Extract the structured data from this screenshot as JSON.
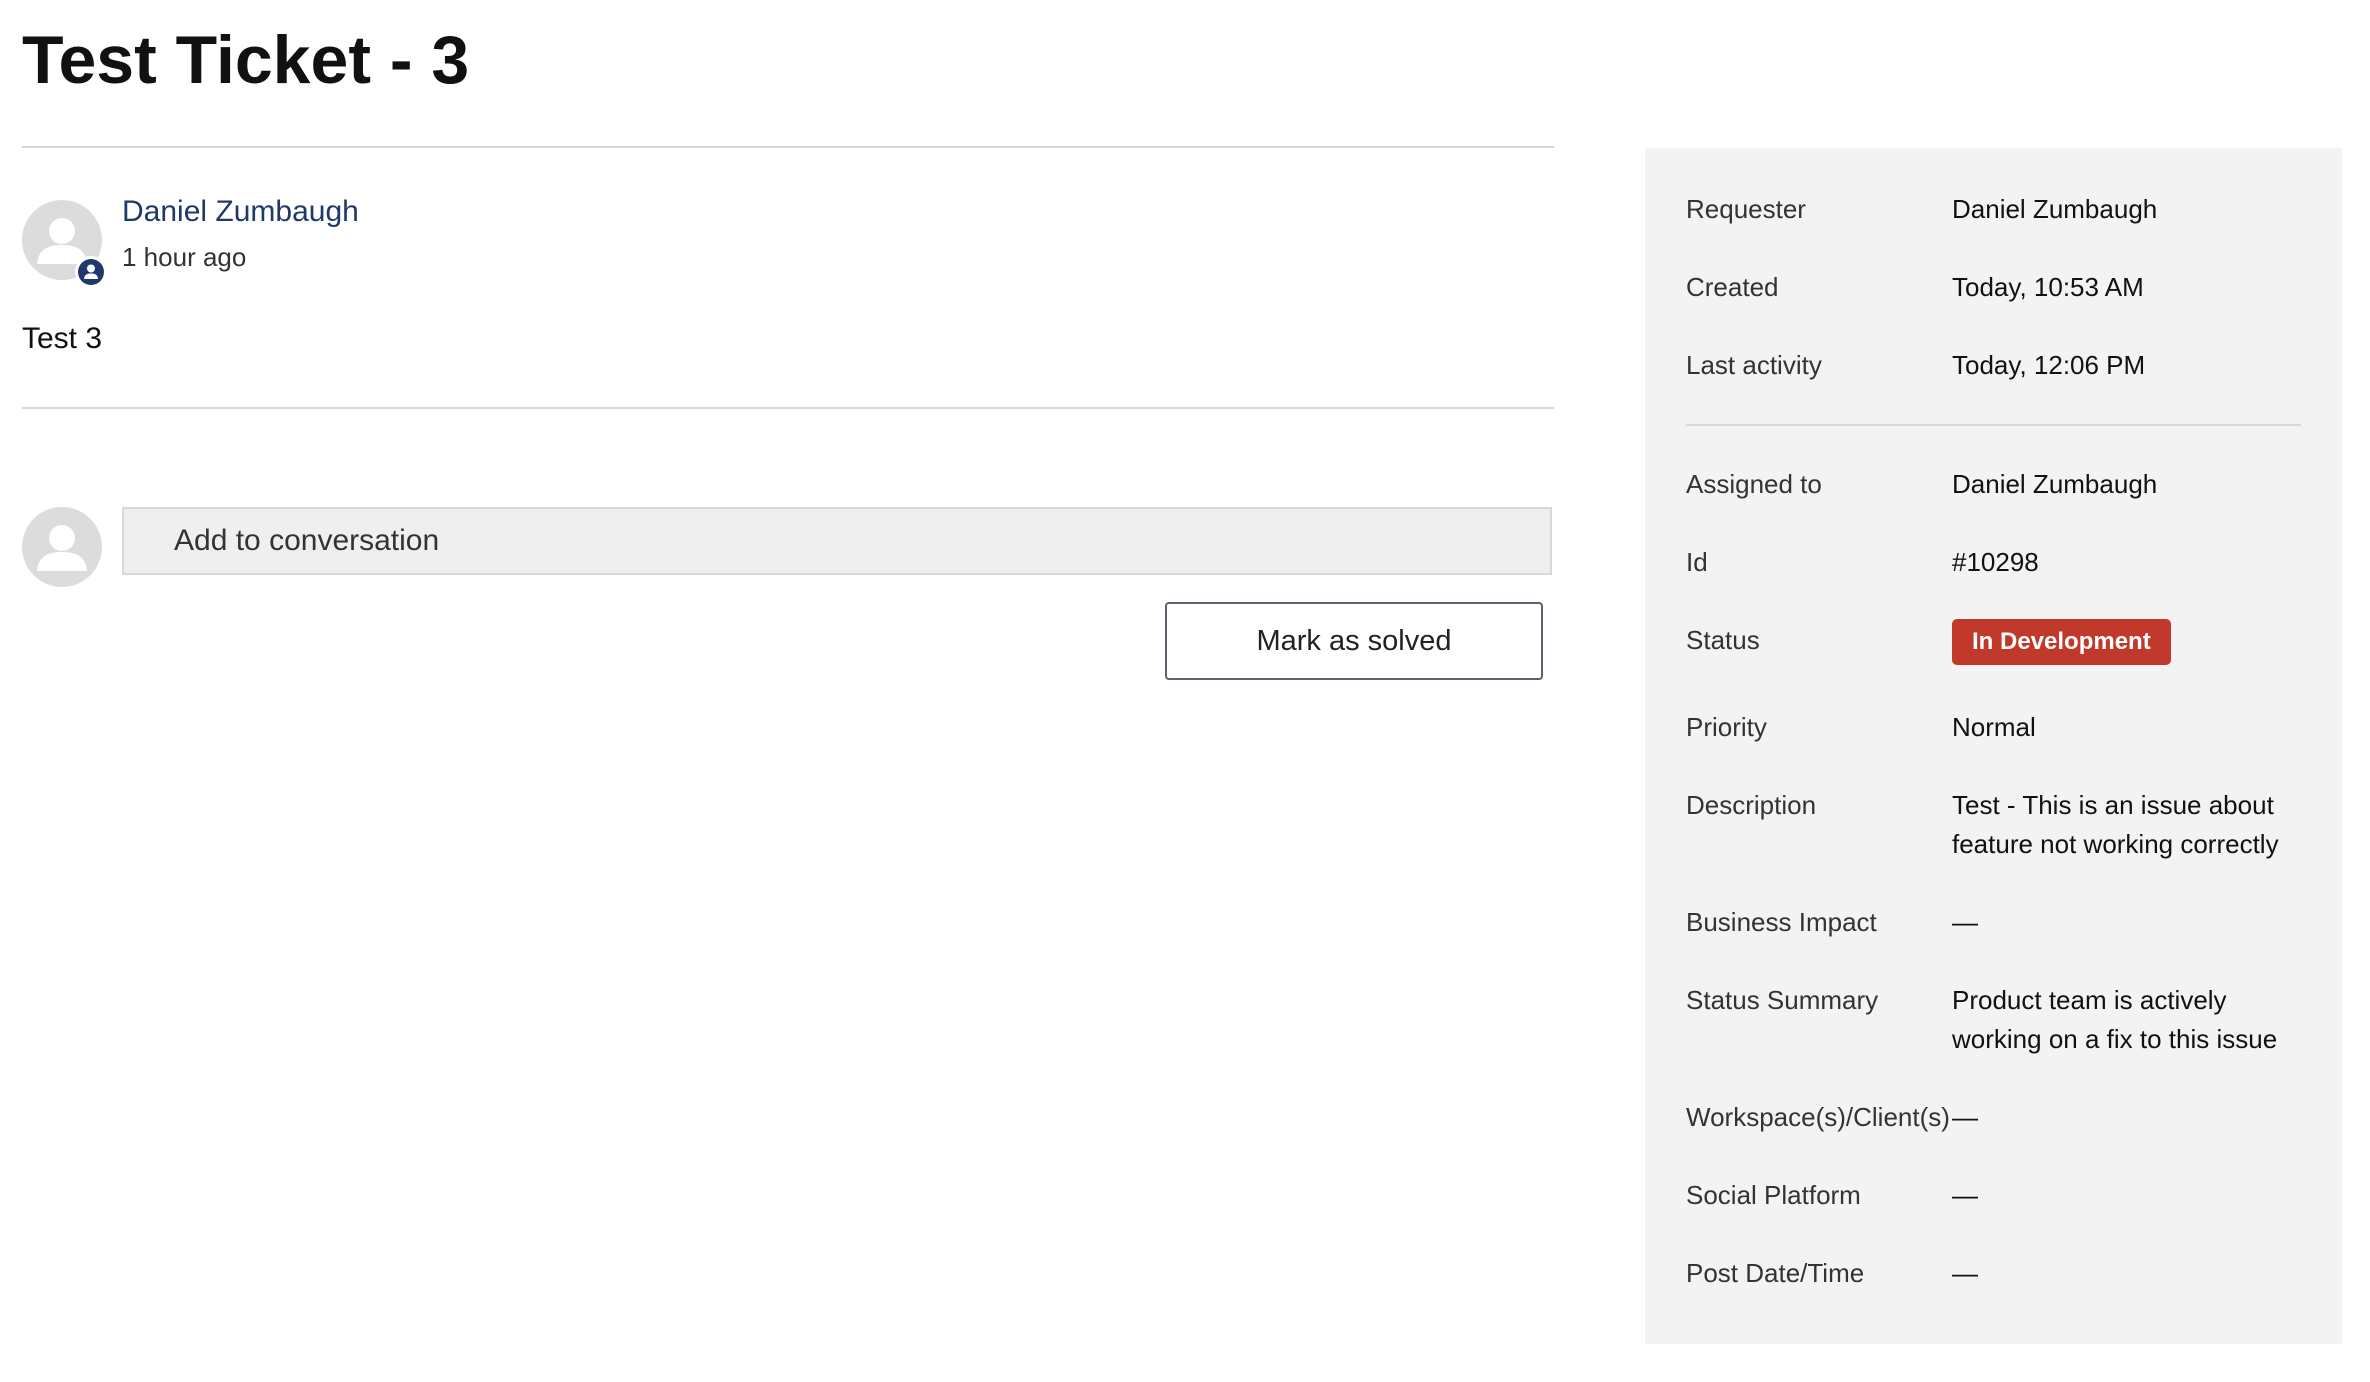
{
  "ticket": {
    "title": "Test Ticket - 3"
  },
  "comment": {
    "author": "Daniel Zumbaugh",
    "time": "1 hour ago",
    "body": "Test 3"
  },
  "reply": {
    "placeholder": "Add to conversation",
    "solve_label": "Mark as solved"
  },
  "sidebar": {
    "details": [
      {
        "label": "Requester",
        "value": "Daniel Zumbaugh"
      },
      {
        "label": "Created",
        "value": "Today, 10:53 AM"
      },
      {
        "label": "Last activity",
        "value": "Today, 12:06 PM"
      }
    ],
    "fields": [
      {
        "label": "Assigned to",
        "value": "Daniel Zumbaugh"
      },
      {
        "label": "Id",
        "value": "#10298"
      },
      {
        "label": "Status",
        "value": "In Development"
      },
      {
        "label": "Priority",
        "value": "Normal"
      },
      {
        "label": "Description",
        "value": "Test - This is an issue about feature not working correctly"
      },
      {
        "label": "Business Impact",
        "value": "—"
      },
      {
        "label": "Status Summary",
        "value": "Product team is actively working on a fix to this issue"
      },
      {
        "label": "Workspace(s)/Client(s)",
        "value": "—"
      },
      {
        "label": "Social Platform",
        "value": "—"
      },
      {
        "label": "Post Date/Time",
        "value": "—"
      }
    ]
  },
  "colors": {
    "status_badge": "#c0392b",
    "author_link": "#1f3a6a",
    "sidebar_background": "#f3f3f3"
  },
  "icons": {
    "avatar": "user-avatar-icon",
    "agent_badge": "agent-badge-icon"
  }
}
